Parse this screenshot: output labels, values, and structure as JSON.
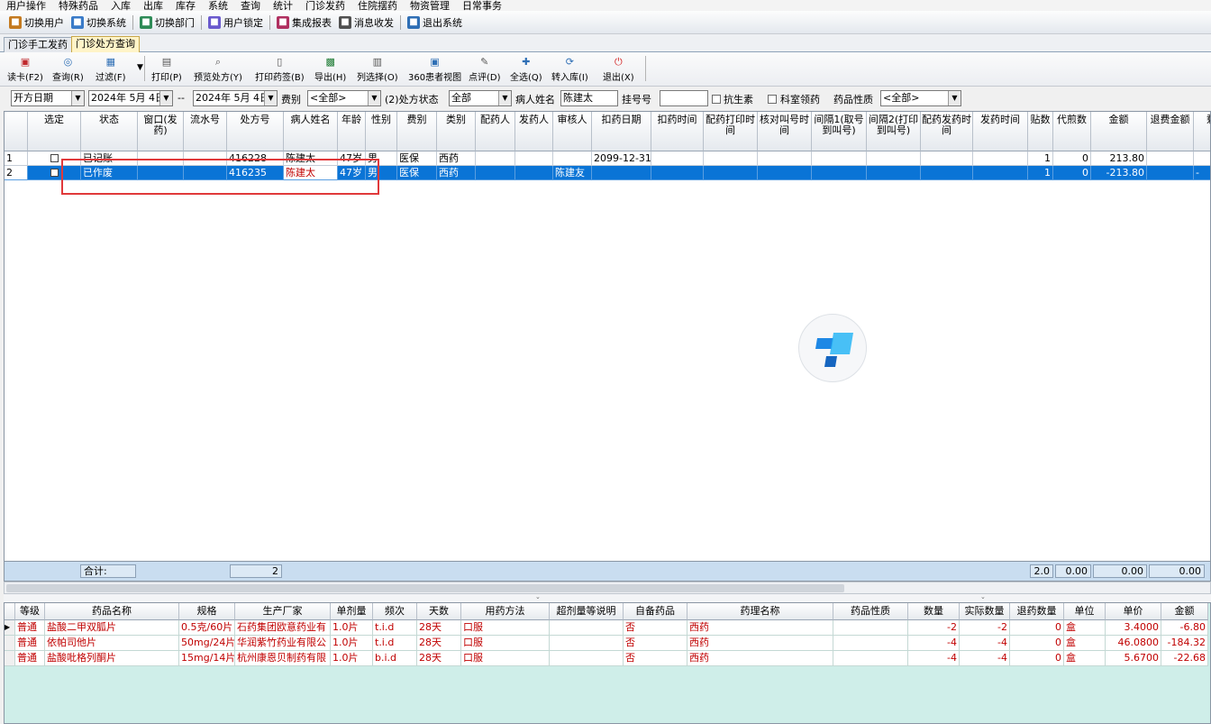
{
  "menu": [
    "用户操作",
    "特殊药品",
    "入库",
    "出库",
    "库存",
    "系统",
    "查询",
    "统计",
    "门诊发药",
    "住院摆药",
    "物资管理",
    "日常事务"
  ],
  "toolbar": [
    {
      "label": "切换用户",
      "icon": "switch-user-icon",
      "color": "#c47a20"
    },
    {
      "label": "切换系统",
      "icon": "switch-system-icon",
      "color": "#3a7bc8"
    },
    {
      "label": "切换部门",
      "icon": "switch-dept-icon",
      "color": "#2e8b57"
    },
    {
      "label": "用户锁定",
      "icon": "lock-user-icon",
      "color": "#6a5acd"
    },
    {
      "label": "集成报表",
      "icon": "report-icon",
      "color": "#b03060"
    },
    {
      "label": "消息收发",
      "icon": "message-icon",
      "color": "#505050"
    },
    {
      "label": "退出系统",
      "icon": "exit-icon",
      "color": "#2f6fb5"
    }
  ],
  "tabs": [
    "门诊手工发药",
    "门诊处方查询"
  ],
  "actions": [
    {
      "label": "读卡(F2)",
      "icon": "card-reader-icon",
      "glyph": "▣",
      "color": "#c0282d"
    },
    {
      "label": "查询(R)",
      "icon": "search-icon",
      "glyph": "◎",
      "color": "#2f6fb5"
    },
    {
      "label": "过滤(F)",
      "icon": "filter-icon",
      "glyph": "▦",
      "color": "#2f6fb5"
    },
    {
      "label": "打印(P)",
      "icon": "print-icon",
      "glyph": "▤",
      "color": "#555555"
    },
    {
      "label": "预览处方(Y)",
      "icon": "preview-icon",
      "glyph": "⌕",
      "color": "#555555"
    },
    {
      "label": "打印药签(B)",
      "icon": "print-label-icon",
      "glyph": "▯",
      "color": "#555555"
    },
    {
      "label": "导出(H)",
      "icon": "export-icon",
      "glyph": "▩",
      "color": "#1e7b34"
    },
    {
      "label": "列选择(O)",
      "icon": "column-select-icon",
      "glyph": "▥",
      "color": "#555555"
    },
    {
      "label": "360患者视图",
      "icon": "patient-view-icon",
      "glyph": "▣",
      "color": "#2f6fb5"
    },
    {
      "label": "点评(D)",
      "icon": "comment-icon",
      "glyph": "✎",
      "color": "#555555"
    },
    {
      "label": "全选(Q)",
      "icon": "select-all-icon",
      "glyph": "✚",
      "color": "#2f6fb5"
    },
    {
      "label": "转入库(I)",
      "icon": "transfer-icon",
      "glyph": "⟳",
      "color": "#2f6fb5"
    },
    {
      "label": "退出(X)",
      "icon": "power-icon",
      "glyph": "⏻",
      "color": "#d21f1f"
    }
  ],
  "filters": {
    "date_type": "开方日期",
    "date_from": "2024年 5月 4日",
    "range_sep": "--",
    "date_to": "2024年 5月 4日",
    "fee_label": "费别",
    "fee_value": "<全部>",
    "status_label": "(2)处方状态",
    "status_value": "全部",
    "patient_label": "病人姓名",
    "patient_value": "陈建太",
    "reg_label": "挂号号",
    "reg_value": "",
    "antibiotic_label": "抗生素",
    "dept_label": "科室领药",
    "nature_label": "药品性质",
    "nature_value": "<全部>"
  },
  "top_headers": [
    "",
    "选定",
    "状态",
    "窗口(发药)",
    "流水号",
    "处方号",
    "病人姓名",
    "年龄",
    "性别",
    "费别",
    "类别",
    "配药人",
    "发药人",
    "审核人",
    "扣药日期",
    "扣药时间",
    "配药打印时间",
    "核对叫号时间",
    "间隔1(取号到叫号)",
    "间隔2(打印到叫号)",
    "配药发药时间",
    "发药时间",
    "贴数",
    "代煎数",
    "金额",
    "退费金额",
    "剩"
  ],
  "top_rows": [
    {
      "idx": "1",
      "status": "已记账",
      "window": "",
      "serial": "",
      "rx": "416228",
      "name": "陈建太",
      "age": "47岁",
      "sex": "男",
      "fee": "医保",
      "kind": "西药",
      "dispenser": "",
      "issuer": "",
      "auditor": "",
      "deduct_date": "2099-12-31",
      "tie": "1",
      "decoct": "0",
      "amount": "213.80",
      "refund": ""
    },
    {
      "idx": "2",
      "status": "已作废",
      "window": "",
      "serial": "",
      "rx": "416235",
      "name": "陈建太",
      "age": "47岁",
      "sex": "男",
      "fee": "医保",
      "kind": "西药",
      "dispenser": "",
      "issuer": "",
      "auditor": "陈建友",
      "deduct_date": "",
      "tie": "1",
      "decoct": "0",
      "amount": "-213.80",
      "refund": "",
      "last": "-"
    }
  ],
  "footer": {
    "total_label": "合计:",
    "count": "2",
    "tie_sum": "2.0",
    "decoct_sum": "0.00",
    "amount_sum": "0.00",
    "refund_sum": "0.00"
  },
  "bottom_headers": [
    "",
    "等级",
    "药品名称",
    "规格",
    "生产厂家",
    "单剂量",
    "频次",
    "天数",
    "用药方法",
    "超剂量等说明",
    "自备药品",
    "药理名称",
    "药品性质",
    "数量",
    "实际数量",
    "退药数量",
    "单位",
    "单价",
    "金额"
  ],
  "bottom_rows": [
    {
      "marker": "▶",
      "level": "普通",
      "drug": "盐酸二甲双胍片",
      "spec": "0.5克/60片",
      "maker": "石药集团欧意药业有",
      "dose": "1.0片",
      "freq": "t.i.d",
      "days": "28天",
      "method": "口服",
      "over": "",
      "own": "否",
      "pharm": "西药",
      "nature": "",
      "qty": "-2",
      "actual": "-2",
      "ret": "0",
      "unit": "盒",
      "price": "3.4000",
      "amt": "-6.80"
    },
    {
      "marker": "",
      "level": "普通",
      "drug": "依帕司他片",
      "spec": "50mg/24片",
      "maker": "华润紫竹药业有限公",
      "dose": "1.0片",
      "freq": "t.i.d",
      "days": "28天",
      "method": "口服",
      "over": "",
      "own": "否",
      "pharm": "西药",
      "nature": "",
      "qty": "-4",
      "actual": "-4",
      "ret": "0",
      "unit": "盒",
      "price": "46.0800",
      "amt": "-184.32"
    },
    {
      "marker": "",
      "level": "普通",
      "drug": "盐酸吡格列酮片",
      "spec": "15mg/14片",
      "maker": "杭州康恩贝制药有限",
      "dose": "1.0片",
      "freq": "b.i.d",
      "days": "28天",
      "method": "口服",
      "over": "",
      "own": "否",
      "pharm": "西药",
      "nature": "",
      "qty": "-4",
      "actual": "-4",
      "ret": "0",
      "unit": "盒",
      "price": "5.6700",
      "amt": "-22.68"
    }
  ]
}
